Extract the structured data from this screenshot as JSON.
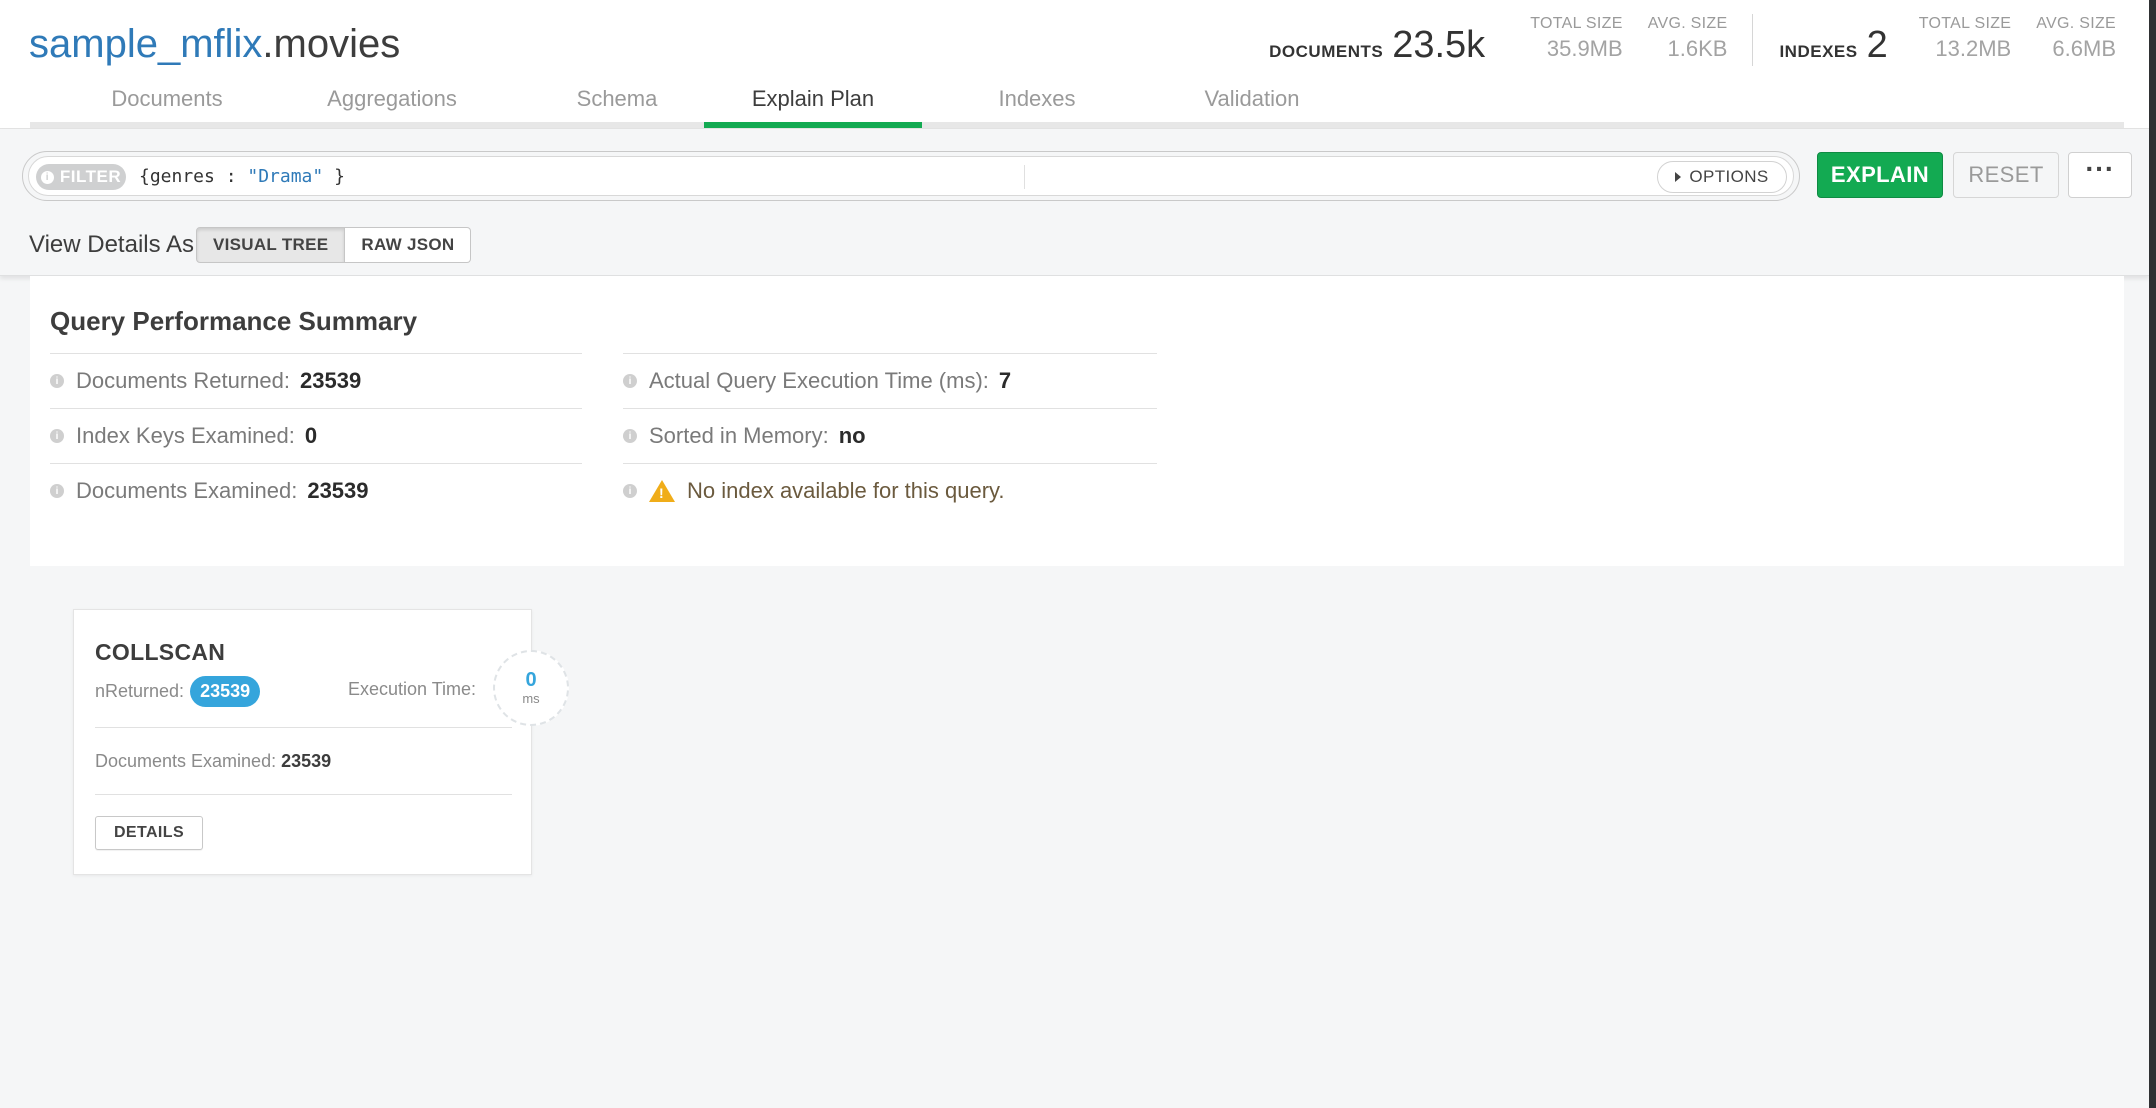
{
  "namespace": {
    "db": "sample_mflix",
    "collection": ".movies"
  },
  "stats": {
    "documents_label": "DOCUMENTS",
    "documents_value": "23.5k",
    "doc_total_size_label": "TOTAL SIZE",
    "doc_total_size_value": "35.9MB",
    "doc_avg_size_label": "AVG. SIZE",
    "doc_avg_size_value": "1.6KB",
    "indexes_label": "INDEXES",
    "indexes_value": "2",
    "idx_total_size_label": "TOTAL SIZE",
    "idx_total_size_value": "13.2MB",
    "idx_avg_size_label": "AVG. SIZE",
    "idx_avg_size_value": "6.6MB"
  },
  "tabs": [
    "Documents",
    "Aggregations",
    "Schema",
    "Explain Plan",
    "Indexes",
    "Validation"
  ],
  "active_tab": "Explain Plan",
  "query_bar": {
    "filter_label": "FILTER",
    "filter_key": "{genres : ",
    "filter_string": "\"Drama\"",
    "filter_close": " }",
    "options_label": "OPTIONS",
    "explain_label": "EXPLAIN",
    "reset_label": "RESET",
    "more_label": "···"
  },
  "view_as": {
    "label": "View Details As",
    "options": [
      "VISUAL TREE",
      "RAW JSON"
    ],
    "selected": "VISUAL TREE"
  },
  "summary": {
    "title": "Query Performance Summary",
    "left": [
      {
        "label": "Documents Returned:",
        "value": "23539"
      },
      {
        "label": "Index Keys Examined:",
        "value": "0"
      },
      {
        "label": "Documents Examined:",
        "value": "23539"
      }
    ],
    "right": [
      {
        "label": "Actual Query Execution Time (ms):",
        "value": "7"
      },
      {
        "label": "Sorted in Memory:",
        "value": "no"
      }
    ],
    "warning": "No index available for this query."
  },
  "stage": {
    "name": "COLLSCAN",
    "nreturned_label": "nReturned:",
    "nreturned_value": "23539",
    "exec_label": "Execution Time:",
    "exec_value": "0",
    "exec_unit": "ms",
    "docs_examined_label": "Documents Examined:",
    "docs_examined_value": "23539",
    "details_label": "DETAILS"
  },
  "colors": {
    "accent_green": "#13aa52",
    "db_blue": "#2f7ab8",
    "badge_blue": "#35a5dc",
    "warning_yellow": "#f0ad19"
  }
}
